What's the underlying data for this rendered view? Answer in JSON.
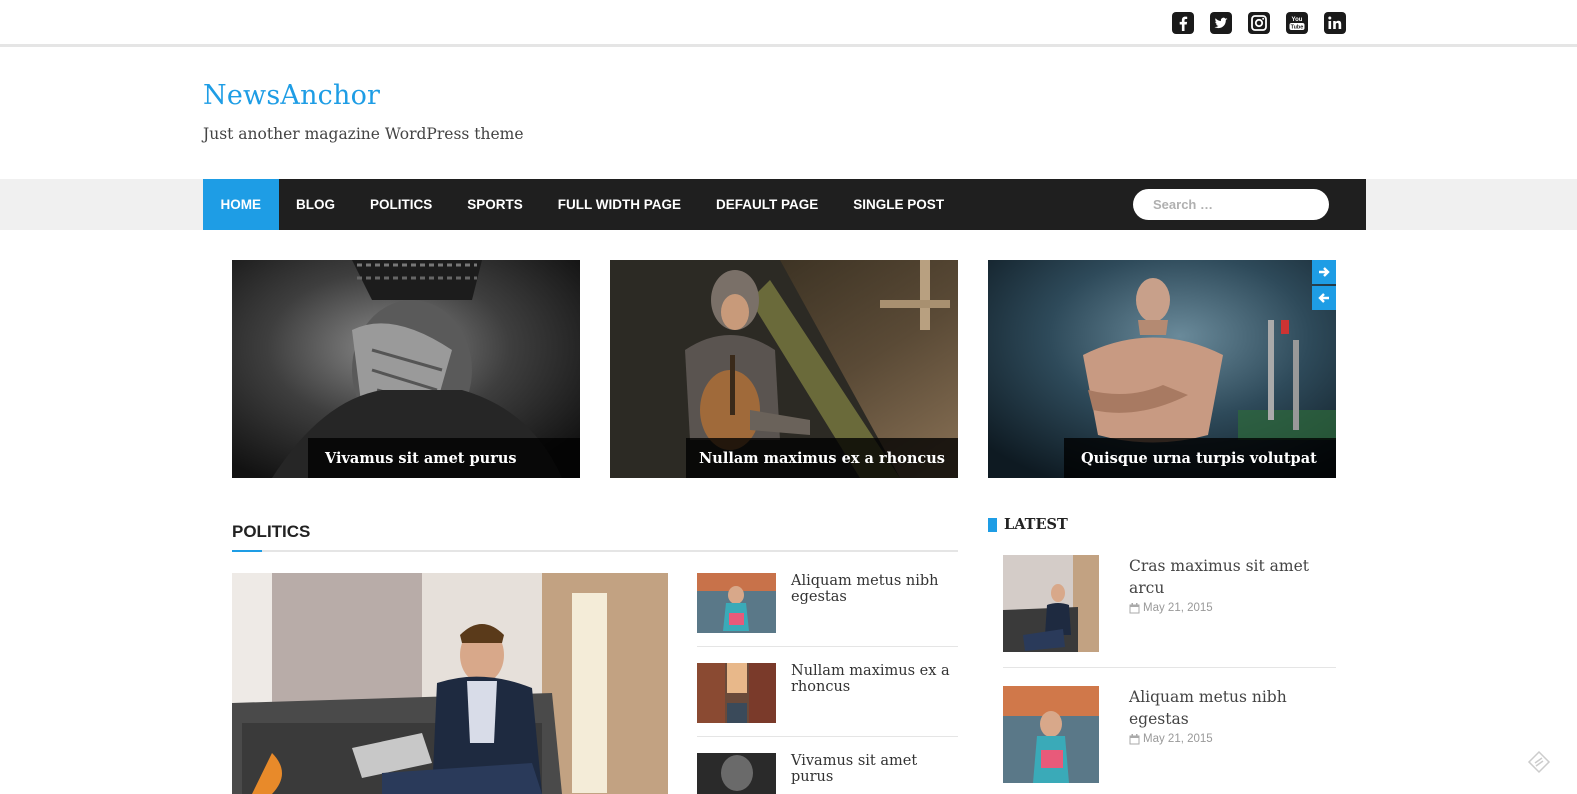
{
  "social": [
    {
      "icon": "facebook-icon"
    },
    {
      "icon": "twitter-icon"
    },
    {
      "icon": "instagram-icon"
    },
    {
      "icon": "youtube-icon"
    },
    {
      "icon": "linkedin-icon"
    }
  ],
  "site": {
    "title": "NewsAnchor",
    "description": "Just another magazine WordPress theme"
  },
  "nav": {
    "items": [
      {
        "label": "HOME"
      },
      {
        "label": "BLOG"
      },
      {
        "label": "POLITICS"
      },
      {
        "label": "SPORTS"
      },
      {
        "label": "FULL WIDTH PAGE"
      },
      {
        "label": "DEFAULT PAGE"
      },
      {
        "label": "SINGLE POST"
      }
    ],
    "search_placeholder": "Search …"
  },
  "slider": {
    "slides": [
      {
        "caption": "Vivamus sit amet purus"
      },
      {
        "caption": "Nullam maximus ex a rhoncus"
      },
      {
        "caption": "Quisque urna turpis volutpat"
      }
    ]
  },
  "politics": {
    "title": "POLITICS",
    "items": [
      {
        "title": "Aliquam metus nibh egestas"
      },
      {
        "title": "Nullam maximus ex a rhoncus"
      },
      {
        "title": "Vivamus sit amet purus"
      }
    ]
  },
  "latest": {
    "title": "LATEST",
    "items": [
      {
        "title": "Cras maximus sit amet arcu",
        "date": "May 21, 2015"
      },
      {
        "title": "Aliquam metus nibh egestas",
        "date": "May 21, 2015"
      }
    ]
  },
  "colors": {
    "accent": "#1e9de5",
    "nav_bg": "#1f1f1f"
  }
}
